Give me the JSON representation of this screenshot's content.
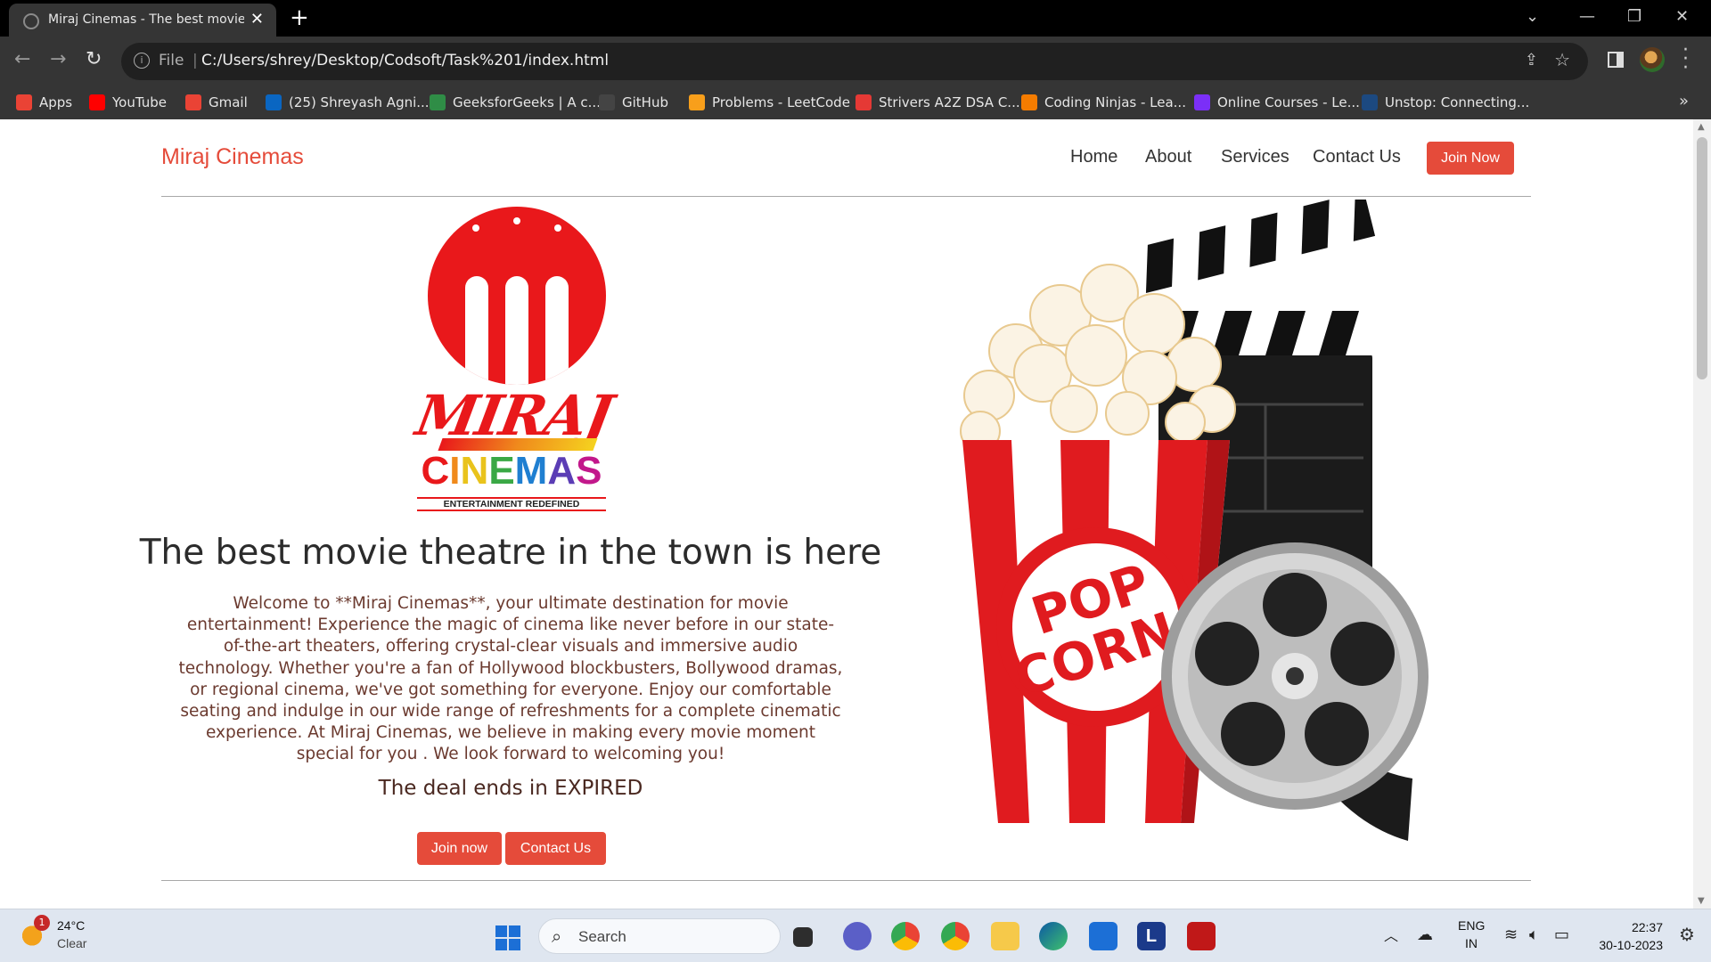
{
  "browser": {
    "tab_title": "Miraj Cinemas - The best movie",
    "tab_close": "✕",
    "new_tab": "+",
    "address_prefix": "File",
    "address_url": "C:/Users/shrey/Desktop/Codsoft/Task%201/index.html",
    "bookmarks": [
      {
        "label": "Apps",
        "icon": "apps-grid-icon",
        "color": "#ea4335"
      },
      {
        "label": "YouTube",
        "icon": "youtube-icon",
        "color": "#ff0000"
      },
      {
        "label": "Gmail",
        "icon": "gmail-icon",
        "color": "#ea4335"
      },
      {
        "label": "(25) Shreyash Agni...",
        "icon": "linkedin-icon",
        "color": "#0a66c2"
      },
      {
        "label": "GeeksforGeeks | A c...",
        "icon": "geeksforgeeks-icon",
        "color": "#2f8d46"
      },
      {
        "label": "GitHub",
        "icon": "github-icon",
        "color": "#444444"
      },
      {
        "label": "Problems - LeetCode",
        "icon": "leetcode-icon",
        "color": "#f89f1b"
      },
      {
        "label": "Strivers A2Z DSA C...",
        "icon": "tuf-icon",
        "color": "#e53935"
      },
      {
        "label": "Coding Ninjas - Lea...",
        "icon": "coding-ninjas-icon",
        "color": "#f57c00"
      },
      {
        "label": "Online Courses - Le...",
        "icon": "online-courses-icon",
        "color": "#7b2ff7"
      },
      {
        "label": "Unstop: Connecting...",
        "icon": "unstop-icon",
        "color": "#1c4980"
      }
    ]
  },
  "site": {
    "brand": "Miraj Cinemas",
    "nav": [
      "Home",
      "About",
      "Services",
      "Contact Us"
    ],
    "join_top": "Join Now",
    "logo": {
      "wordmark": "MIRAJ",
      "cinemas": "CINEMAS",
      "tagline": "ENTERTAINMENT REDEFINED"
    },
    "headline": "The best movie theatre in the town is here",
    "paragraph": "Welcome to **Miraj Cinemas**, your ultimate destination for movie entertainment! Experience the magic of cinema like never before in our state-of-the-art theaters, offering crystal-clear visuals and immersive audio technology. Whether you're a fan of Hollywood blockbusters, Bollywood dramas, or regional cinema, we've got something for everyone. Enjoy our comfortable seating and indulge in our wide range of refreshments for a complete cinematic experience. At Miraj Cinemas, we believe in making every movie moment special for you . We look forward to welcoming you!",
    "deal": "The deal ends in EXPIRED",
    "cta_join": "Join now",
    "cta_contact": "Contact Us",
    "hero_art_text": "POP CORN",
    "accent_color": "#e54b3a"
  },
  "taskbar": {
    "temperature": "24°C",
    "condition": "Clear",
    "weather_badge": "1",
    "search_label": "Search",
    "lang_1": "ENG",
    "lang_2": "IN",
    "time": "22:37",
    "date": "30-10-2023"
  }
}
